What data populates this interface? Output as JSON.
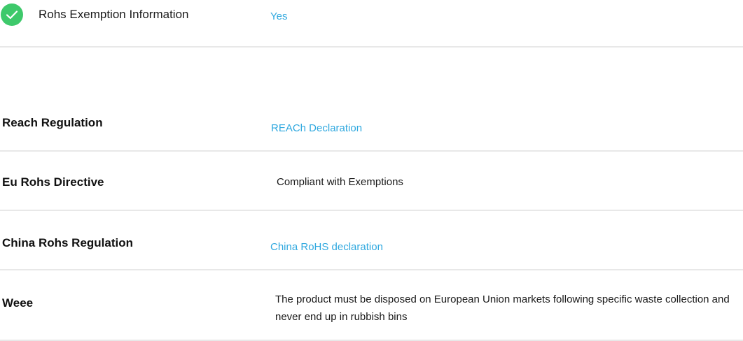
{
  "rohs_exemption": {
    "icon": "check-circle-icon",
    "icon_color": "#3ec96b",
    "label": "Rohs Exemption Information",
    "value": "Yes"
  },
  "regulations": [
    {
      "label": "Reach Regulation",
      "value": "REACh Declaration",
      "value_type": "link"
    },
    {
      "label": "Eu Rohs Directive",
      "value": "Compliant with Exemptions",
      "value_type": "text"
    },
    {
      "label": "China Rohs Regulation",
      "value": "China RoHS declaration",
      "value_type": "link"
    },
    {
      "label": "Weee",
      "value": "The product must be disposed on European Union markets following specific waste collection and never end up in rubbish bins",
      "value_type": "text"
    }
  ],
  "colors": {
    "link": "#2fa8df",
    "divider": "#e8e8e8",
    "check": "#3ec96b"
  }
}
